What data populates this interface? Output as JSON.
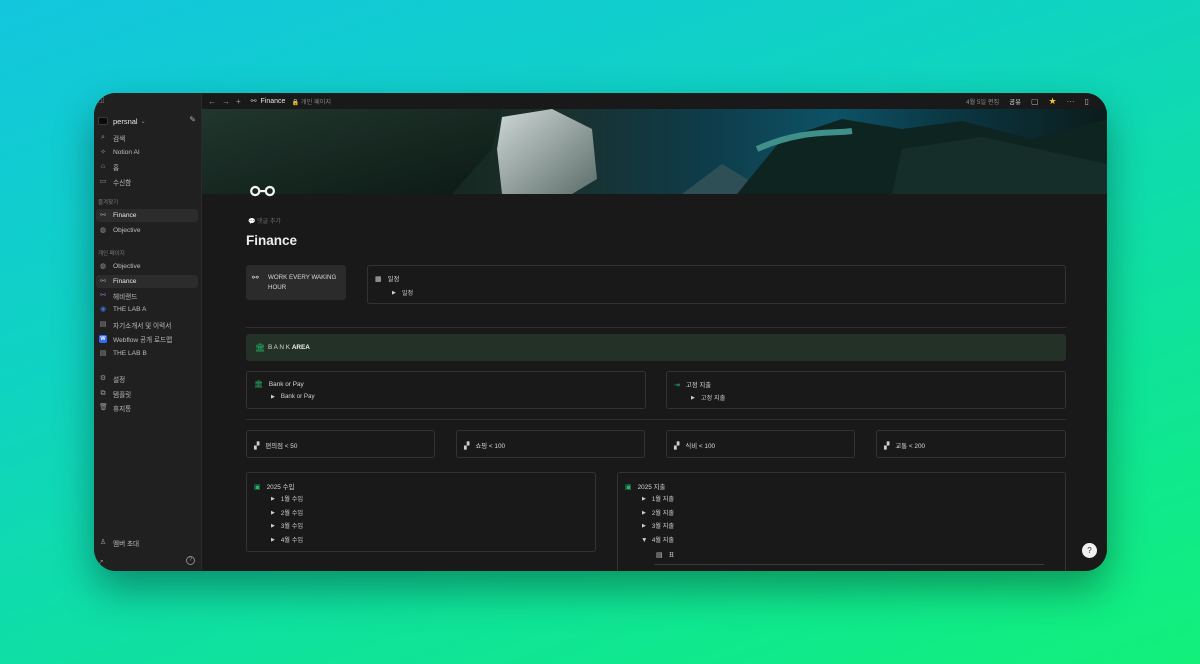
{
  "window": {
    "top_left_glyph": "◫"
  },
  "workspace": {
    "name": "persnal",
    "caret": "⌄"
  },
  "sidebar": {
    "top_items": [
      {
        "label": "검색",
        "icon": "search-icon",
        "glyph": "⌕"
      },
      {
        "label": "Notion AI",
        "icon": "ai-icon",
        "glyph": "✧"
      },
      {
        "label": "홈",
        "icon": "home-icon",
        "glyph": "⌂"
      },
      {
        "label": "수신함",
        "icon": "inbox-icon",
        "glyph": "▭"
      }
    ],
    "favorites_header": "즐겨찾기",
    "favorites": [
      {
        "label": "Finance",
        "icon": "telescope-icon",
        "glyph": "⚯"
      },
      {
        "label": "Objective",
        "icon": "compass-icon",
        "glyph": "◍"
      }
    ],
    "private_header": "개인 페이지",
    "private": [
      {
        "label": "Objective",
        "icon": "compass-icon",
        "glyph": "◍"
      },
      {
        "label": "Finance",
        "icon": "telescope-icon",
        "glyph": "⚯"
      },
      {
        "label": "헤비랜드",
        "icon": "telescope-purple-icon",
        "glyph": "⚯"
      },
      {
        "label": "THE LAB A",
        "icon": "lab-icon",
        "glyph": "◉"
      },
      {
        "label": "자기소개서 및 이력서",
        "icon": "document-icon",
        "glyph": "▤"
      },
      {
        "label": "Webflow 공개 로드맵",
        "icon": "webflow-icon",
        "glyph": "W"
      },
      {
        "label": "THE LAB B",
        "icon": "document-icon",
        "glyph": "▤"
      }
    ],
    "bottom_items": [
      {
        "label": "설정",
        "icon": "gear-icon",
        "glyph": "⚙"
      },
      {
        "label": "템플릿",
        "icon": "template-icon",
        "glyph": "⧉"
      },
      {
        "label": "휴지통",
        "icon": "trash-icon",
        "glyph": "🗑"
      }
    ],
    "invite": {
      "label": "멤버 초대",
      "glyph": "♙"
    },
    "help_glyph": "?"
  },
  "topbar": {
    "back": "←",
    "forward": "→",
    "new": "+",
    "title": "Finance",
    "privacy": "🔒 개인 페이지",
    "edited": "4월 5일 편집",
    "share": "공유",
    "comment_glyph": "▢",
    "star_glyph": "★",
    "more_glyph": "···",
    "window_glyph": "▯"
  },
  "page": {
    "icon": "⚯",
    "add_comment": "💬 댓글 추가",
    "title": "Finance"
  },
  "blocks": {
    "callout_work": "WORK EVERY WAKING HOUR",
    "schedule": {
      "title": "일정",
      "toggle": "일정"
    },
    "bank_area": {
      "spaced": "B A N K",
      "bold": "AREA"
    },
    "bank_or_pay": {
      "title": "Bank or Pay",
      "toggle": "Bank or Pay"
    },
    "fixed_expense": {
      "title": "고정 지출",
      "toggle": "고정 지출"
    },
    "budgets": [
      "편의점 < 50",
      "쇼핑 < 100",
      "식비 < 100",
      "교통 < 200"
    ],
    "income": {
      "title": "2025 수입",
      "items": [
        "1월 수입",
        "2월 수입",
        "3월 수입",
        "4월 수입"
      ]
    },
    "expense": {
      "title": "2025 지출",
      "items": [
        "1월 지출",
        "2월 지출",
        "3월 지출",
        "4월 지출"
      ],
      "table_label": "표"
    }
  },
  "colors": {
    "accent_green": "#23b36a",
    "star": "#f2c531"
  }
}
